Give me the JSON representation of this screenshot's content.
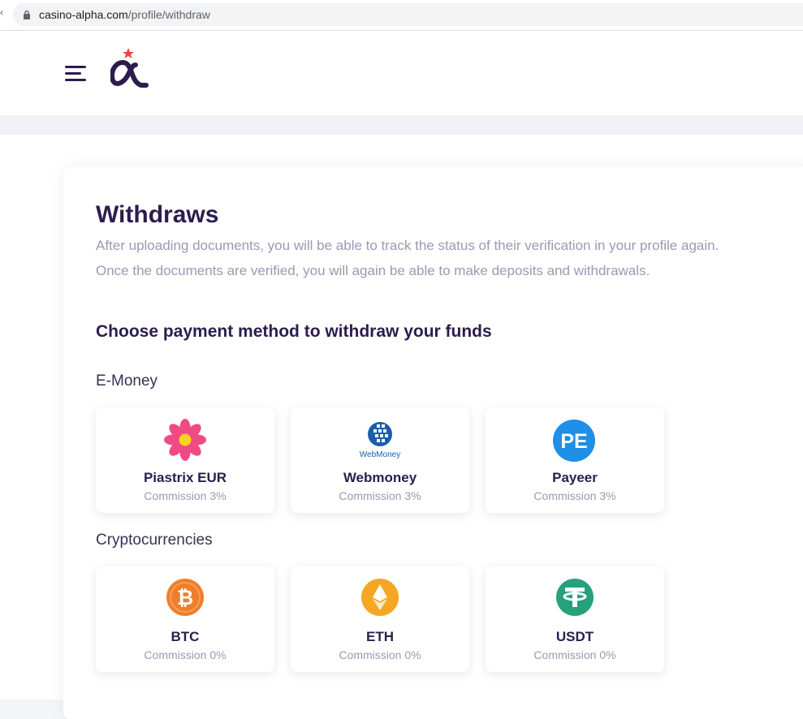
{
  "browser": {
    "url_domain": "casino-alpha.com",
    "url_path": "/profile/withdraw"
  },
  "page": {
    "title": "Withdraws",
    "description": "After uploading documents, you will be able to track the status of their verification in your profile again. Once the documents are verified, you will again be able to make deposits and withdrawals.",
    "section_title": "Choose payment method to withdraw your funds"
  },
  "categories": [
    {
      "label": "E-Money",
      "methods": [
        {
          "name": "Piastrix EUR",
          "commission": "Commission 3%",
          "icon": "piastrix-icon"
        },
        {
          "name": "Webmoney",
          "commission": "Commission 3%",
          "icon": "webmoney-icon",
          "icon_text": "WebMoney"
        },
        {
          "name": "Payeer",
          "commission": "Commission 3%",
          "icon": "payeer-icon",
          "icon_text": "PE"
        }
      ]
    },
    {
      "label": "Cryptocurrencies",
      "methods": [
        {
          "name": "BTC",
          "commission": "Commission 0%",
          "icon": "bitcoin-icon"
        },
        {
          "name": "ETH",
          "commission": "Commission 0%",
          "icon": "ethereum-icon"
        },
        {
          "name": "USDT",
          "commission": "Commission 0%",
          "icon": "tether-icon"
        }
      ]
    }
  ],
  "colors": {
    "brand_dark": "#2b1d4e",
    "muted_text": "#9d98b2",
    "logo_star": "#e8473b",
    "payeer_blue": "#1f8fe8",
    "bitcoin_orange": "#f07e2a",
    "ethereum_orange": "#f5a623",
    "tether_green": "#26a17b",
    "piastrix_pink": "#ef4a83"
  }
}
